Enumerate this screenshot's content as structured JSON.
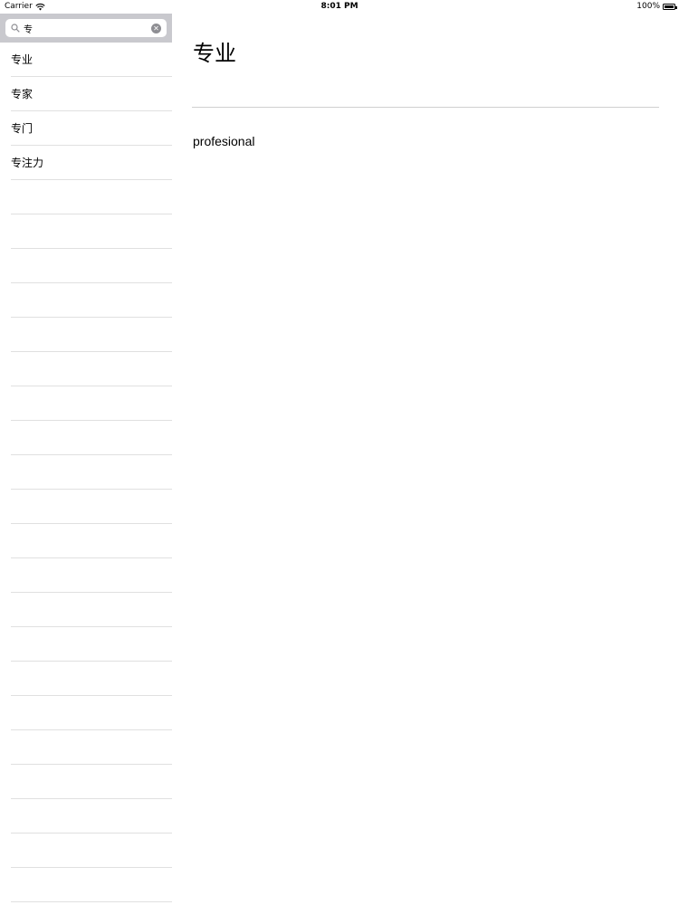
{
  "status_bar": {
    "carrier": "Carrier",
    "time": "8:01 PM",
    "battery": "100%"
  },
  "search": {
    "value": "专",
    "placeholder": ""
  },
  "results": [
    "专业",
    "专家",
    "专门",
    "专注力"
  ],
  "detail": {
    "title": "专业",
    "definition": "profesional"
  },
  "icons": {
    "wifi": "wifi-icon",
    "battery": "battery-icon",
    "search": "search-icon",
    "clear": "clear-icon"
  },
  "colors": {
    "search_bar_bg": "#c9c9ce",
    "separator": "#e0e0e0"
  }
}
